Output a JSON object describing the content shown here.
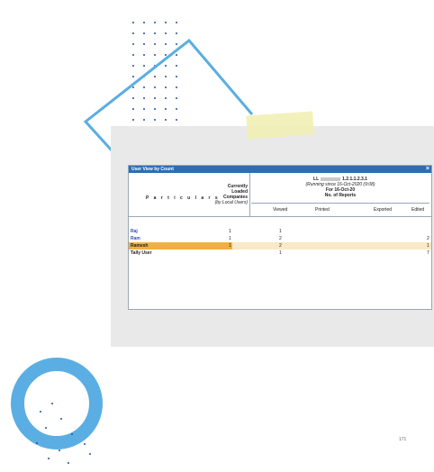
{
  "window": {
    "title": "User View by Count",
    "close_glyph": "×"
  },
  "header": {
    "particulars_label": "P a r t i c u l a r s",
    "currently_loaded": "Currently",
    "loaded": "Loaded",
    "companies": "Companies",
    "by_local_users": "(by Local Users)",
    "company_prefix": "LL",
    "company_suffix": "1.2.1.1.2.3.1",
    "running_since": "(Running since 16-Oct-2020 (9:08)",
    "for_date": "For 16-Oct-20",
    "no_of_reports": "No. of Reports",
    "columns": {
      "viewed": "Viewed",
      "printed": "Printed",
      "exported": "Exported",
      "edited": "Edited"
    }
  },
  "rows": [
    {
      "name": "Raj",
      "loaded": "1",
      "viewed": "1",
      "edited": "",
      "highlighted": false,
      "color": "#2f4fc0"
    },
    {
      "name": "Ram",
      "loaded": "1",
      "viewed": "2",
      "edited": "2",
      "highlighted": false,
      "color": "#2f4fc0"
    },
    {
      "name": "Ramesh",
      "loaded": "1",
      "viewed": "2",
      "edited": "1",
      "highlighted": true,
      "color": "#222222"
    },
    {
      "name": "Tally User",
      "loaded": "",
      "viewed": "1",
      "edited": "7",
      "highlighted": false,
      "color": "#222222"
    }
  ],
  "page_number": "171",
  "colors": {
    "titlebar": "#2f6db0",
    "accent_blue": "#5aaee3",
    "highlight": "#f0b040"
  }
}
